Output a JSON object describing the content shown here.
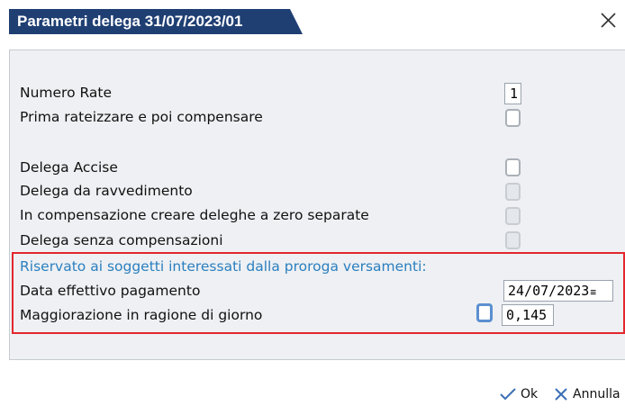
{
  "dialog": {
    "title": "Parametri delega 31/07/2023/01",
    "close_label": "Close"
  },
  "fields": {
    "numero_rate_label": "Numero Rate",
    "numero_rate_value": "1",
    "prima_rateizzare_label": "Prima rateizzare e poi compensare",
    "delega_accise_label": "Delega Accise",
    "delega_ravvedimento_label": "Delega da ravvedimento",
    "compensazione_zero_label": "In compensazione creare deleghe a zero separate",
    "delega_senza_comp_label": "Delega senza compensazioni"
  },
  "proroga": {
    "section_label": "Riservato ai soggetti interessati dalla proroga versamenti:",
    "data_pagamento_label": "Data effettivo pagamento",
    "data_pagamento_value": "24/07/2023",
    "maggiorazione_label": "Maggiorazione in ragione di giorno",
    "maggiorazione_value": "0,145"
  },
  "buttons": {
    "ok_label": "Ok",
    "annulla_label": "Annulla"
  },
  "colors": {
    "title_bg": "#1f3f73",
    "section_text": "#2a7fbf",
    "highlight_border": "#e3262d"
  }
}
